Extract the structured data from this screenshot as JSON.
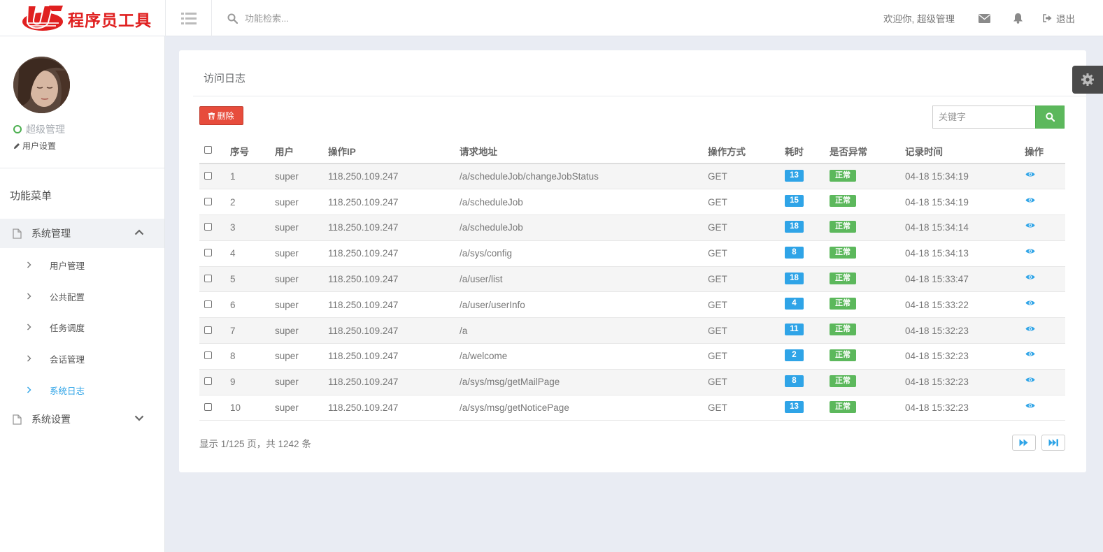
{
  "brand": {
    "name": "程序员工具"
  },
  "search": {
    "placeholder": "功能检索..."
  },
  "header": {
    "welcome": "欢迎你, 超级管理",
    "logout_label": "退出"
  },
  "user": {
    "role": "超级管理",
    "settings_label": "用户设置"
  },
  "sidebar": {
    "menu_title": "功能菜单",
    "groups": [
      {
        "label": "系统管理",
        "expanded": true,
        "items": [
          {
            "label": "用户管理"
          },
          {
            "label": "公共配置"
          },
          {
            "label": "任务调度"
          },
          {
            "label": "会话管理"
          },
          {
            "label": "系统日志",
            "active": true
          }
        ]
      },
      {
        "label": "系统设置",
        "expanded": false
      }
    ]
  },
  "panel": {
    "title": "访问日志",
    "delete_label": "删除",
    "keyword_placeholder": "关键字"
  },
  "table": {
    "columns": [
      "序号",
      "用户",
      "操作IP",
      "请求地址",
      "操作方式",
      "耗时",
      "是否异常",
      "记录时间",
      "操作"
    ],
    "rows": [
      {
        "no": "1",
        "user": "super",
        "ip": "118.250.109.247",
        "url": "/a/scheduleJob/changeJobStatus",
        "method": "GET",
        "duration": "13",
        "status": "正常",
        "time": "04-18 15:34:19"
      },
      {
        "no": "2",
        "user": "super",
        "ip": "118.250.109.247",
        "url": "/a/scheduleJob",
        "method": "GET",
        "duration": "15",
        "status": "正常",
        "time": "04-18 15:34:19"
      },
      {
        "no": "3",
        "user": "super",
        "ip": "118.250.109.247",
        "url": "/a/scheduleJob",
        "method": "GET",
        "duration": "18",
        "status": "正常",
        "time": "04-18 15:34:14"
      },
      {
        "no": "4",
        "user": "super",
        "ip": "118.250.109.247",
        "url": "/a/sys/config",
        "method": "GET",
        "duration": "8",
        "status": "正常",
        "time": "04-18 15:34:13"
      },
      {
        "no": "5",
        "user": "super",
        "ip": "118.250.109.247",
        "url": "/a/user/list",
        "method": "GET",
        "duration": "18",
        "status": "正常",
        "time": "04-18 15:33:47"
      },
      {
        "no": "6",
        "user": "super",
        "ip": "118.250.109.247",
        "url": "/a/user/userInfo",
        "method": "GET",
        "duration": "4",
        "status": "正常",
        "time": "04-18 15:33:22"
      },
      {
        "no": "7",
        "user": "super",
        "ip": "118.250.109.247",
        "url": "/a",
        "method": "GET",
        "duration": "11",
        "status": "正常",
        "time": "04-18 15:32:23"
      },
      {
        "no": "8",
        "user": "super",
        "ip": "118.250.109.247",
        "url": "/a/welcome",
        "method": "GET",
        "duration": "2",
        "status": "正常",
        "time": "04-18 15:32:23"
      },
      {
        "no": "9",
        "user": "super",
        "ip": "118.250.109.247",
        "url": "/a/sys/msg/getMailPage",
        "method": "GET",
        "duration": "8",
        "status": "正常",
        "time": "04-18 15:32:23"
      },
      {
        "no": "10",
        "user": "super",
        "ip": "118.250.109.247",
        "url": "/a/sys/msg/getNoticePage",
        "method": "GET",
        "duration": "13",
        "status": "正常",
        "time": "04-18 15:32:23"
      }
    ]
  },
  "pagination": {
    "info": "显示 1/125 页，共 1242 条"
  },
  "colors": {
    "brand_red": "#e02020",
    "accent_blue": "#2fa4e7",
    "success_green": "#5cb85c",
    "danger_red": "#e74c3c"
  },
  "icons": [
    "list-icon",
    "search-icon",
    "envelope-icon",
    "bell-icon",
    "sign-out-icon",
    "pencil-icon",
    "file-icon",
    "chevron-up-icon",
    "chevron-down-icon",
    "chevron-right-icon",
    "trash-icon",
    "eye-icon",
    "forward-icon",
    "fast-forward-icon",
    "gear-icon"
  ]
}
